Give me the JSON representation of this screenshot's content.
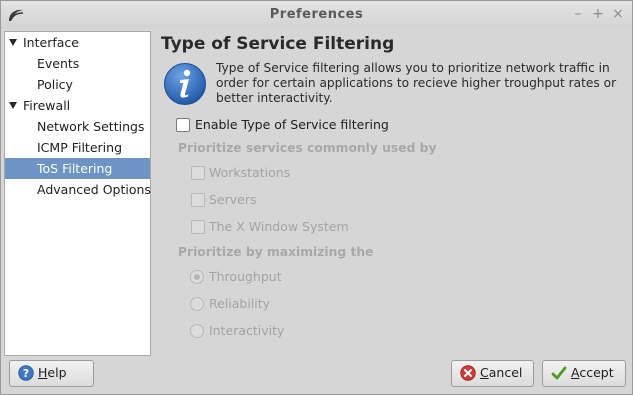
{
  "window": {
    "title": "Preferences",
    "minimize": "–",
    "maximize": "+",
    "close": "×"
  },
  "sidebar": {
    "items": [
      {
        "label": "Interface",
        "level": 0,
        "expanded": true
      },
      {
        "label": "Events",
        "level": 1
      },
      {
        "label": "Policy",
        "level": 1
      },
      {
        "label": "Firewall",
        "level": 0,
        "expanded": true
      },
      {
        "label": "Network Settings",
        "level": 1
      },
      {
        "label": "ICMP Filtering",
        "level": 1
      },
      {
        "label": "ToS Filtering",
        "level": 1,
        "selected": true
      },
      {
        "label": "Advanced Options",
        "level": 1
      }
    ]
  },
  "main": {
    "heading": "Type of Service Filtering",
    "description": "Type of Service filtering allows you to prioritize network traffic in order for certain applications to recieve higher troughput rates or better interactivity.",
    "enable_label": "Enable Type of Service filtering",
    "enable_checked": false,
    "services_section": "Prioritize services commonly used by",
    "services": [
      {
        "label": "Workstations",
        "checked": false
      },
      {
        "label": "Servers",
        "checked": false
      },
      {
        "label": "The X Window System",
        "checked": false
      }
    ],
    "maximize_section": "Prioritize by maximizing the",
    "maximize_options": [
      {
        "label": "Throughput",
        "selected": true
      },
      {
        "label": "Reliability",
        "selected": false
      },
      {
        "label": "Interactivity",
        "selected": false
      }
    ]
  },
  "buttons": {
    "help": {
      "mnemonic": "H",
      "rest": "elp"
    },
    "cancel": {
      "mnemonic": "C",
      "rest": "ancel"
    },
    "accept": {
      "mnemonic": "A",
      "rest": "ccept"
    }
  },
  "colors": {
    "selection": "#6d94c4",
    "info_icon": "#2f6ab8",
    "cancel_icon": "#c9302c",
    "accept_icon": "#5aa32a"
  }
}
